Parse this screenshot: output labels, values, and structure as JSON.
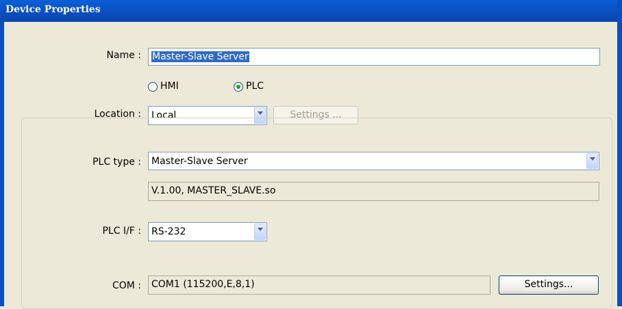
{
  "window": {
    "title": "Device Properties"
  },
  "name": {
    "label": "Name :",
    "value": "Master-Slave Server"
  },
  "role": {
    "options": [
      {
        "label": "HMI",
        "selected": false
      },
      {
        "label": "PLC",
        "selected": true
      }
    ]
  },
  "location": {
    "label": "Location :",
    "value": "Local",
    "settings_label": "Settings ..."
  },
  "plc_type": {
    "label": "PLC type :",
    "value": "Master-Slave Server",
    "version": "V.1.00, MASTER_SLAVE.so"
  },
  "plc_if": {
    "label": "PLC I/F :",
    "value": "RS-232"
  },
  "com": {
    "label": "COM :",
    "value": "COM1 (115200,E,8,1)",
    "settings_label": "Settings..."
  },
  "colors": {
    "titlebar": "#0a4fbf",
    "selection": "#316ac5",
    "dialog_bg": "#ece9d8"
  }
}
